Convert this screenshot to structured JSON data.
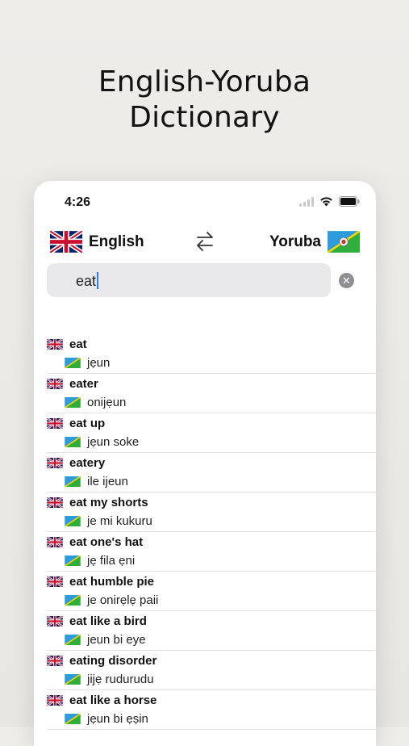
{
  "headline": {
    "line1": "English-Yoruba",
    "line2": "Dictionary"
  },
  "status": {
    "time": "4:26"
  },
  "languages": {
    "source": "English",
    "target": "Yoruba"
  },
  "search": {
    "value": "eat"
  },
  "icons": {
    "uk_flag": "uk-flag-icon",
    "yoruba_flag": "yoruba-flag-icon",
    "swap": "swap-arrows-icon",
    "clear": "clear-icon",
    "signal": "signal-icon",
    "wifi": "wifi-icon",
    "battery": "battery-icon"
  },
  "results": [
    {
      "english": "eat",
      "yoruba": "jẹun"
    },
    {
      "english": "eater",
      "yoruba": "onijẹun"
    },
    {
      "english": "eat up",
      "yoruba": "jẹun soke"
    },
    {
      "english": "eatery",
      "yoruba": "ile ijeun"
    },
    {
      "english": "eat my shorts",
      "yoruba": "je mi kukuru"
    },
    {
      "english": "eat one's hat",
      "yoruba": "jẹ fila ẹni"
    },
    {
      "english": "eat humble pie",
      "yoruba": "je onirẹlẹ paii"
    },
    {
      "english": "eat like a bird",
      "yoruba": "jeun bi eye"
    },
    {
      "english": "eating disorder",
      "yoruba": "jijẹ rudurudu"
    },
    {
      "english": "eat like a horse",
      "yoruba": "jẹun bi ẹṣin"
    }
  ]
}
